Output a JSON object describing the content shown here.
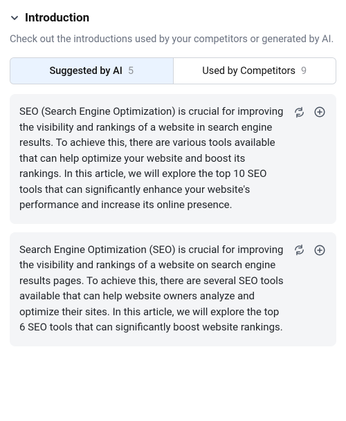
{
  "section": {
    "title": "Introduction",
    "description": "Check out the introductions used by your competitors or generated by AI."
  },
  "tabs": {
    "ai": {
      "label": "Suggested by AI",
      "count": "5"
    },
    "competitors": {
      "label": "Used by Competitors",
      "count": "9"
    }
  },
  "suggestions": [
    {
      "text": "SEO (Search Engine Optimization) is crucial for improving the visibility and rankings of a website in search engine results. To achieve this, there are various tools available that can help optimize your website and boost its rankings. In this article, we will explore the top 10 SEO tools that can significantly enhance your website's performance and increase its online presence."
    },
    {
      "text": "Search Engine Optimization (SEO) is crucial for improving the visibility and rankings of a website on search engine results pages. To achieve this, there are several SEO tools available that can help website owners analyze and optimize their sites. In this article, we will explore the top 6 SEO tools that can significantly boost website rankings."
    }
  ]
}
